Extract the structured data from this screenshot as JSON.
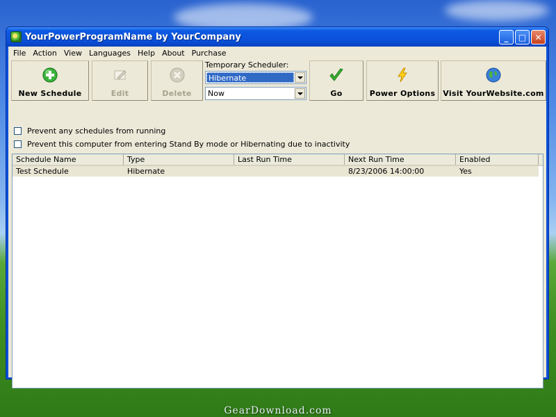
{
  "window": {
    "title": "YourPowerProgramName by YourCompany",
    "minimize_glyph": "_",
    "maximize_glyph": "□",
    "close_glyph": "✕"
  },
  "menu": [
    "File",
    "Action",
    "View",
    "Languages",
    "Help",
    "About",
    "Purchase"
  ],
  "toolbar": {
    "new_schedule": "New Schedule",
    "edit": "Edit",
    "delete": "Delete",
    "temp_scheduler_label": "Temporary Scheduler:",
    "action_value": "Hibernate",
    "time_value": "Now",
    "go": "Go",
    "power_options": "Power Options",
    "visit_website": "Visit YourWebsite.com"
  },
  "options": {
    "prevent_schedules": "Prevent any schedules from running",
    "prevent_standby": "Prevent this computer from entering Stand By mode or Hibernating due to inactivity"
  },
  "table": {
    "columns": [
      "Schedule Name",
      "Type",
      "Last Run Time",
      "Next Run Time",
      "Enabled"
    ],
    "rows": [
      [
        "Test Schedule",
        "Hibernate",
        "",
        "8/23/2006 14:00:00",
        "Yes"
      ]
    ]
  },
  "watermark": "GearDownload.com",
  "icons": {
    "new_schedule": "green-plus-icon",
    "edit": "edit-icon",
    "delete": "delete-icon",
    "go": "green-check-icon",
    "power_options": "lightning-icon",
    "visit_website": "globe-icon"
  }
}
